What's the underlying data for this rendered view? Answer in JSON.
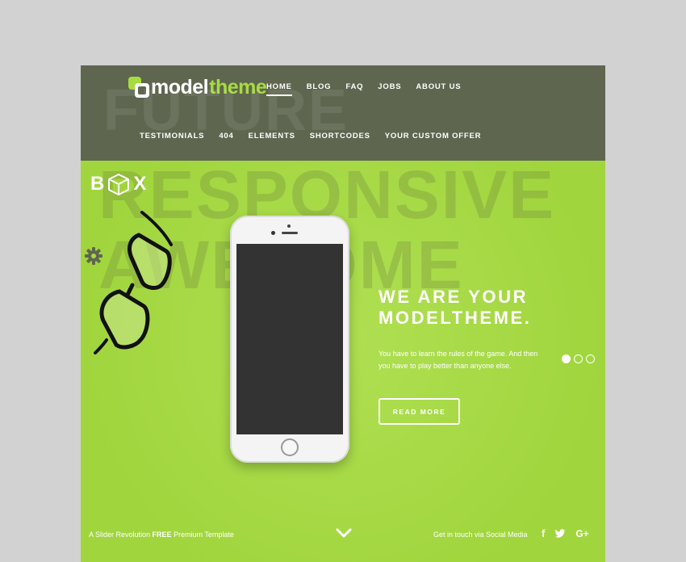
{
  "header": {
    "logo": {
      "part1": "model",
      "part2": "theme"
    },
    "nav_primary": [
      {
        "label": "HOME",
        "active": true
      },
      {
        "label": "BLOG",
        "active": false
      },
      {
        "label": "FAQ",
        "active": false
      },
      {
        "label": "JOBS",
        "active": false
      },
      {
        "label": "ABOUT US",
        "active": false
      }
    ],
    "nav_secondary": [
      {
        "label": "TESTIMONIALS"
      },
      {
        "label": "404"
      },
      {
        "label": "ELEMENTS"
      },
      {
        "label": "SHORTCODES"
      },
      {
        "label": "YOUR CUSTOM OFFER"
      }
    ]
  },
  "background_words": [
    "FUTURE",
    "RESPONSIVE",
    "AWESOME"
  ],
  "box_logo": {
    "left": "B",
    "right": "X"
  },
  "hero": {
    "heading_line1": "WE ARE YOUR",
    "heading_line2": "MODELTHEME.",
    "subtext_line1": "You have to learn the rules of the game. And then",
    "subtext_line2": "you have to play better than anyone else.",
    "button_label": "READ MORE"
  },
  "slider": {
    "total": 3,
    "active_index": 0
  },
  "footer": {
    "left_prefix": "A Slider Revolution ",
    "left_bold": "FREE",
    "left_suffix": " Premium Template",
    "right_text": "Get in touch via Social Media",
    "social_icons": [
      "facebook-icon",
      "twitter-icon",
      "google-plus-icon"
    ]
  },
  "colors": {
    "accent": "#a6dc3f",
    "header_bg": "#5f6650",
    "outer_bg": "#d2d2d2",
    "phone_screen": "#333333"
  }
}
